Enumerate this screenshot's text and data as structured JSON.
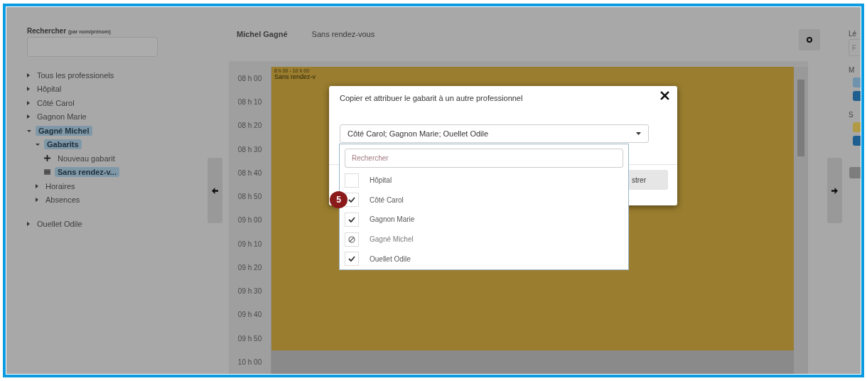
{
  "sidebar": {
    "search_label": "Rechercher",
    "search_hint": "(par nom/prénom)",
    "tree": [
      {
        "label": "Tous les professionels",
        "expanded": false,
        "selected": false
      },
      {
        "label": "Hôpital",
        "expanded": false,
        "selected": false
      },
      {
        "label": "Côté Carol",
        "expanded": false,
        "selected": false
      },
      {
        "label": "Gagnon Marie",
        "expanded": false,
        "selected": false
      },
      {
        "label": "Gagné Michel",
        "expanded": true,
        "selected": true,
        "children": [
          {
            "label": "Gabarits",
            "expanded": true,
            "selected": true,
            "children": [
              {
                "label": "Nouveau gabarit",
                "kind": "add",
                "selected": false
              },
              {
                "label": "Sans rendez-v...",
                "kind": "template",
                "selected": true
              }
            ]
          },
          {
            "label": "Horaires",
            "expanded": false,
            "selected": false
          },
          {
            "label": "Absences",
            "expanded": false,
            "selected": false
          }
        ]
      },
      {
        "label": "Ouellet Odile",
        "expanded": false,
        "selected": false
      }
    ]
  },
  "header": {
    "name": "Michel Gagné",
    "template": "Sans rendez-vous"
  },
  "calendar": {
    "times": [
      "08 h 00",
      "08 h 10",
      "08 h 20",
      "08 h 30",
      "08 h 40",
      "08 h 50",
      "09 h 00",
      "09 h 10",
      "09 h 20",
      "09 h 30",
      "09 h 40",
      "09 h 50",
      "10 h 00"
    ],
    "event": {
      "time": "8 h 00 - 10 h 00",
      "title": "Sans rendez-v",
      "color": "#9a7d2e"
    }
  },
  "right_panel": {
    "label": "Lé",
    "field": "F",
    "groups": [
      {
        "label": "M",
        "chips": [
          {
            "color": "#6f93ad"
          },
          {
            "color": "#1f5f8f"
          }
        ]
      },
      {
        "label": "S",
        "chips": [
          {
            "color": "#b09a45"
          },
          {
            "color": "#1f5f8f"
          }
        ]
      }
    ]
  },
  "modal": {
    "title": "Copier et attribuer le gabarit à un autre professionnel",
    "selection": "Côté Carol; Gagnon Marie; Ouellet Odile",
    "button": "strer",
    "dropdown": {
      "placeholder": "Rechercher",
      "options": [
        {
          "label": "Hôpital",
          "checked": false,
          "disabled": false
        },
        {
          "label": "Côté Carol",
          "checked": true,
          "disabled": false
        },
        {
          "label": "Gagnon Marie",
          "checked": true,
          "disabled": false
        },
        {
          "label": "Gagné Michel",
          "checked": false,
          "disabled": true
        },
        {
          "label": "Ouellet Odile",
          "checked": true,
          "disabled": false
        }
      ]
    }
  },
  "step_badge": "5"
}
